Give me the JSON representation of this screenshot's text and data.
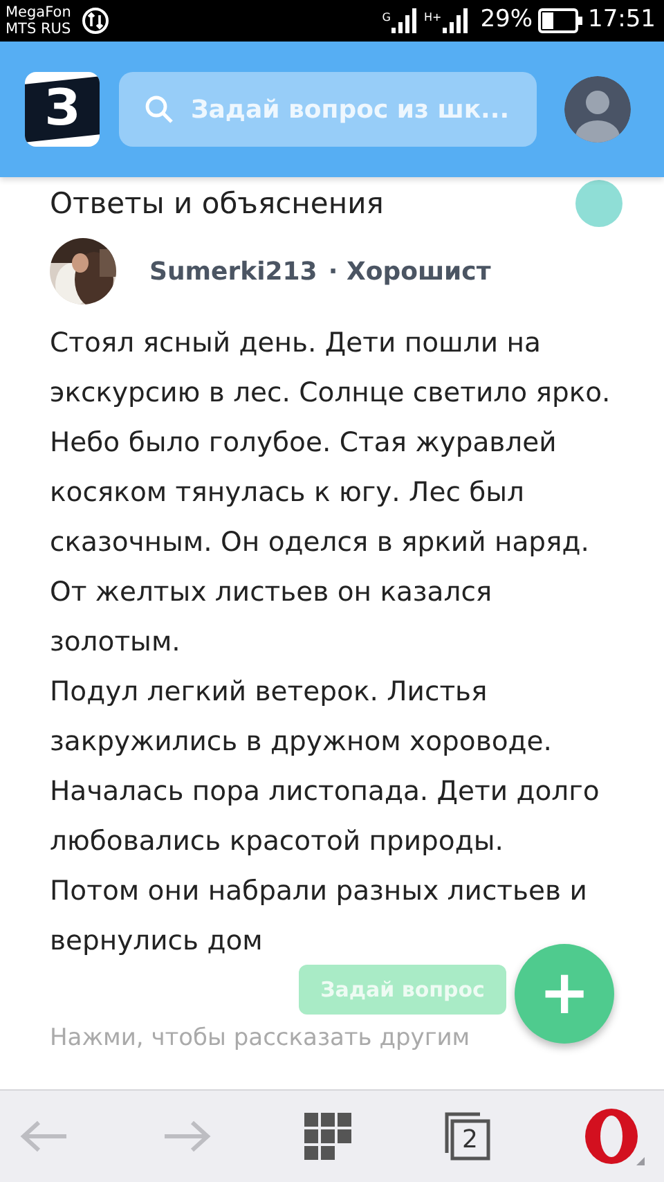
{
  "status_bar": {
    "carriers": [
      "MegaFon",
      "MTS RUS"
    ],
    "network_labels": [
      "G",
      "H+"
    ],
    "battery": "29%",
    "time": "17:51"
  },
  "header": {
    "logo": "З",
    "search": {
      "placeholder": "Задай вопрос из шк..."
    }
  },
  "section_title": "Ответы и объяснения",
  "answer": {
    "author": "Sumerki213",
    "rank": "· Хорошист",
    "paragraphs": [
      "Стоял ясный день. Дети пошли на экскурсию в лес. Солнце светило ярко. Небо было голубое. Стая журавлей косяком тянулась к югу. Лес был сказочным. Он оделся в яркий наряд. От желтых листьев он казался  золотым.",
      "Подул легкий ветерок. Листья закружились в дружном хороводе. Началась пора листопада. Дети долго любовались красотой природы.",
      "Потом они набрали разных листьев и вернулись дом"
    ],
    "footer_hint": "Нажми, чтобы рассказать другим"
  },
  "ask_button": {
    "label": "Задай вопрос",
    "icon": "+"
  },
  "browser_bar": {
    "tabs_count": "2"
  }
}
